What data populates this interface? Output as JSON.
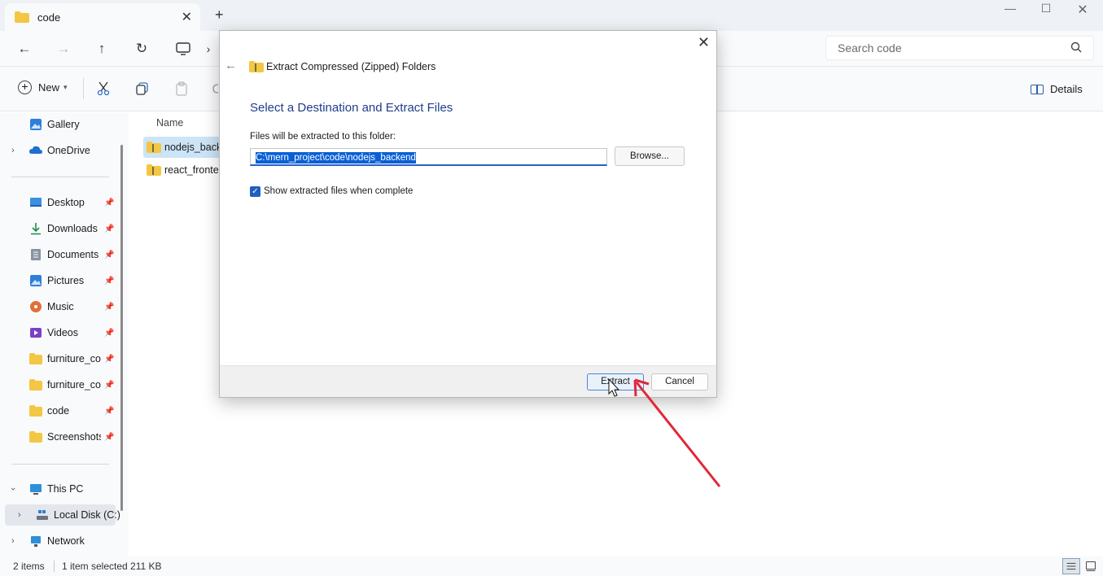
{
  "window": {
    "tab_title": "code",
    "tab_close": "✕",
    "new_tab": "+",
    "min": "—",
    "max": "☐",
    "close": "✕"
  },
  "address": {
    "back": "←",
    "forward": "→",
    "up": "↑",
    "refresh": "↻",
    "crumb_sep": "›",
    "search_placeholder": "Search code"
  },
  "toolbar": {
    "new_label": "New",
    "details_label": "Details"
  },
  "sidebar": {
    "items": [
      {
        "label": "Gallery",
        "icon": "gallery-icon"
      },
      {
        "label": "OneDrive",
        "icon": "cloud-icon"
      },
      {
        "label": "Desktop",
        "icon": "desktop-icon"
      },
      {
        "label": "Downloads",
        "icon": "download-icon"
      },
      {
        "label": "Documents",
        "icon": "document-icon"
      },
      {
        "label": "Pictures",
        "icon": "pictures-icon"
      },
      {
        "label": "Music",
        "icon": "music-icon"
      },
      {
        "label": "Videos",
        "icon": "videos-icon"
      },
      {
        "label": "furniture_coc",
        "icon": "folder-icon"
      },
      {
        "label": "furniture_coc",
        "icon": "folder-icon"
      },
      {
        "label": "code",
        "icon": "folder-icon"
      },
      {
        "label": "Screenshots",
        "icon": "folder-icon"
      },
      {
        "label": "This PC",
        "icon": "computer-icon"
      },
      {
        "label": "Local Disk (C:)",
        "icon": "drive-icon"
      },
      {
        "label": "Network",
        "icon": "network-icon"
      }
    ],
    "pin": "📌"
  },
  "files": {
    "column_name": "Name",
    "rows": [
      {
        "name": "nodejs_backend"
      },
      {
        "name": "react_frontend"
      }
    ]
  },
  "status": {
    "items": "2 items",
    "selected": "1 item selected  211 KB"
  },
  "dialog": {
    "title": "Extract Compressed (Zipped) Folders",
    "heading": "Select a Destination and Extract Files",
    "folder_label": "Files will be extracted to this folder:",
    "path_value": "C:\\mern_project\\code\\nodejs_backend",
    "browse_label": "Browse...",
    "checkbox_label": "Show extracted files when complete",
    "checkbox_checked": true,
    "extract_label": "Extract",
    "cancel_label": "Cancel",
    "close": "✕",
    "back": "←"
  },
  "colors": {
    "folder": "#f2c744",
    "accent": "#1f5fbe",
    "annotation_arrow": "#e0283a"
  }
}
